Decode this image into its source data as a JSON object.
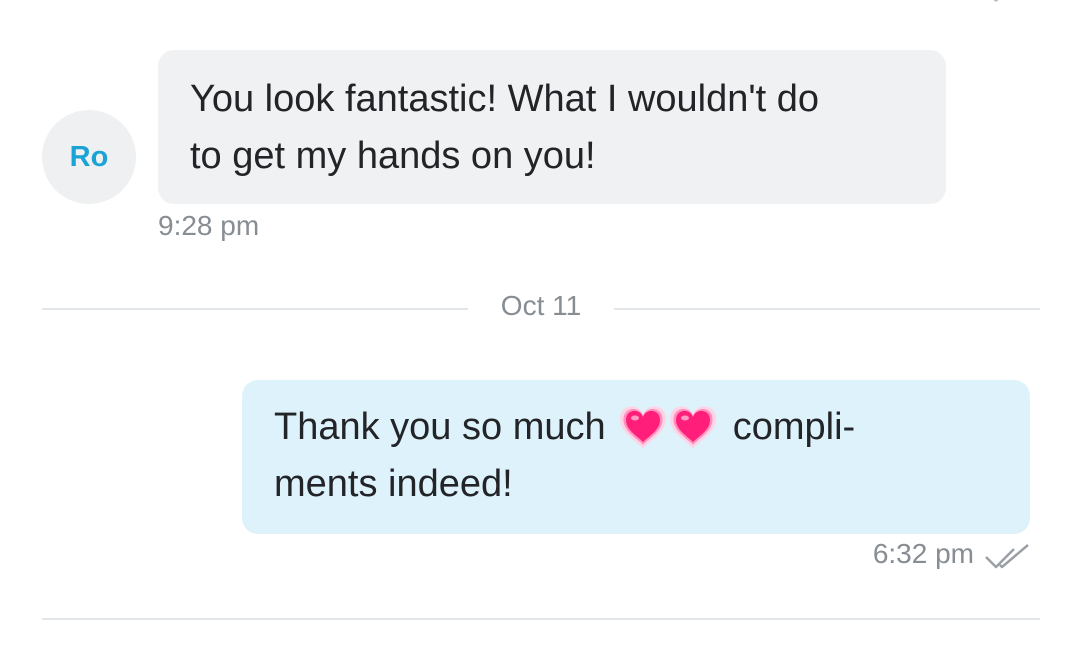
{
  "colors": {
    "incoming_bubble": "#f0f1f3",
    "outgoing_bubble": "#def2fb",
    "avatar_background": "#eef0f2",
    "avatar_text": "#1aa3d4",
    "timestamp_text": "#878d93",
    "divider": "#e3e6e8",
    "heart": "#ff1f7a"
  },
  "icons": {
    "read_receipt": "double-check-icon",
    "emoji": "growing-heart-emoji"
  },
  "messages": [
    {
      "direction": "incoming",
      "avatar_initials": "Ro",
      "lines": [
        "You look fantastic! What I wouldn't do",
        "to get my hands on you!"
      ],
      "time": "9:28 pm"
    },
    {
      "direction": "outgoing",
      "line1_before_emoji": "Thank you so much",
      "line1_after_emoji": "compli-",
      "line2": "ments indeed!",
      "emoji_count": 2,
      "time": "6:32 pm",
      "status": "read"
    }
  ],
  "date_separator": "Oct 11"
}
